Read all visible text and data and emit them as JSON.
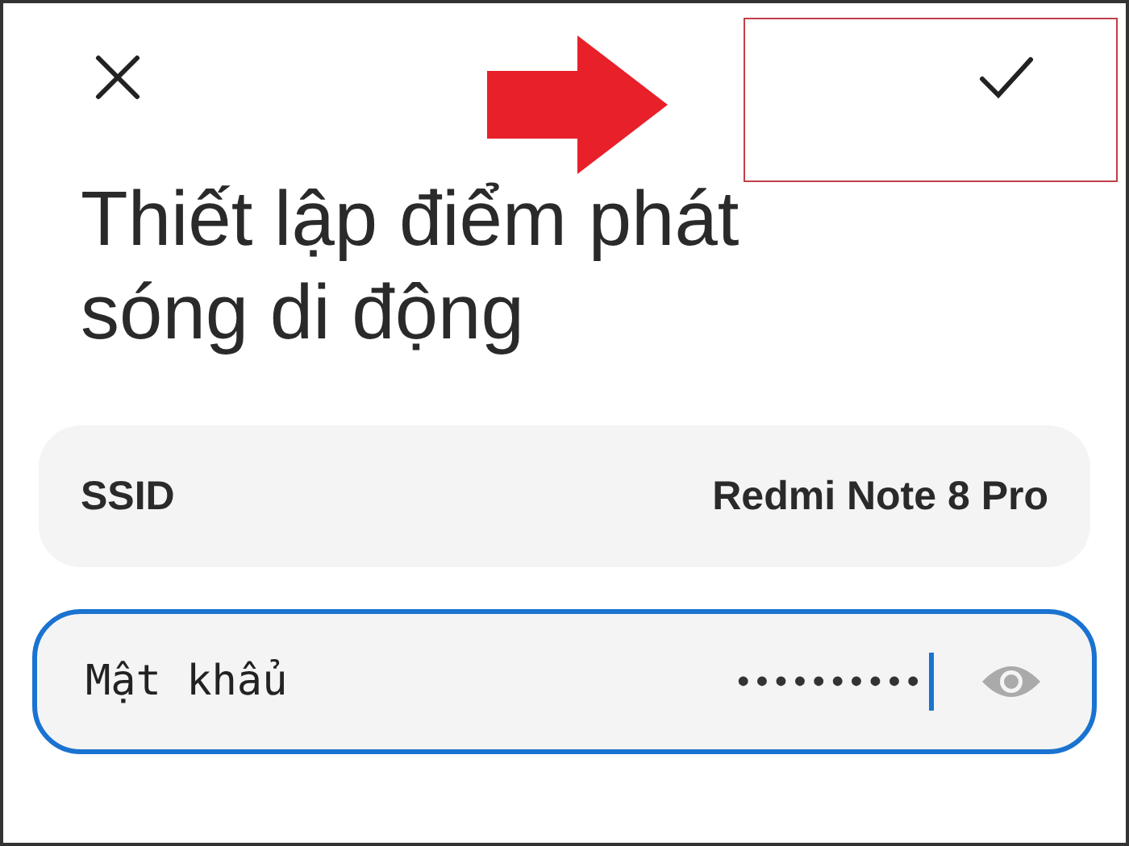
{
  "title": "Thiết lập điểm phát sóng di động",
  "ssid": {
    "label": "SSID",
    "value": "Redmi Note 8 Pro"
  },
  "password": {
    "label": "Mật khẩu",
    "value": "••••••••••",
    "focused": true
  }
}
